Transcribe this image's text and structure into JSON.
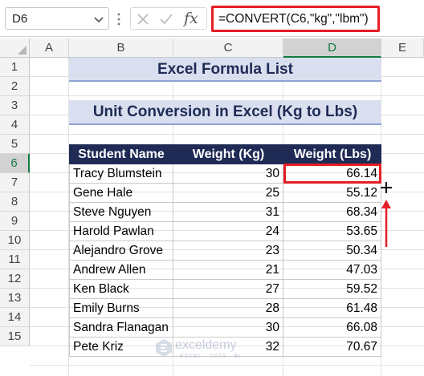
{
  "name_box": {
    "value": "D6"
  },
  "formula_bar": {
    "fx_label": "fx",
    "formula": "=CONVERT(C6,\"kg\",\"lbm\")"
  },
  "columns": [
    {
      "label": "A",
      "selected": false
    },
    {
      "label": "B",
      "selected": false
    },
    {
      "label": "C",
      "selected": false
    },
    {
      "label": "D",
      "selected": true
    },
    {
      "label": "E",
      "selected": false
    }
  ],
  "rows": [
    "1",
    "2",
    "3",
    "4",
    "5",
    "6",
    "7",
    "8",
    "9",
    "10",
    "11",
    "12",
    "13",
    "14",
    "15"
  ],
  "selected_row": "6",
  "titles": {
    "main": "Excel Formula List",
    "sub": "Unit Conversion in Excel (Kg to Lbs)"
  },
  "table": {
    "headers": [
      "Student Name",
      "Weight (Kg)",
      "Weight (Lbs)"
    ],
    "rows": [
      {
        "name": "Tracy Blumstein",
        "kg": "30",
        "lbs": "66.14"
      },
      {
        "name": "Gene Hale",
        "kg": "25",
        "lbs": "55.12"
      },
      {
        "name": "Steve Nguyen",
        "kg": "31",
        "lbs": "68.34"
      },
      {
        "name": "Harold Pawlan",
        "kg": "24",
        "lbs": "53.65"
      },
      {
        "name": "Alejandro Grove",
        "kg": "23",
        "lbs": "50.34"
      },
      {
        "name": "Andrew Allen",
        "kg": "21",
        "lbs": "47.03"
      },
      {
        "name": "Ken Black",
        "kg": "27",
        "lbs": "59.52"
      },
      {
        "name": "Emily Burns",
        "kg": "28",
        "lbs": "61.48"
      },
      {
        "name": "Sandra Flanagan",
        "kg": "30",
        "lbs": "66.08"
      },
      {
        "name": "Pete Kriz",
        "kg": "32",
        "lbs": "70.67"
      }
    ]
  },
  "watermark": {
    "name": "exceldemy",
    "tagline": "EXCEL · DATA · BI"
  },
  "colors": {
    "accent_red": "#e41f25",
    "header_navy": "#1f2a55",
    "title_fill": "#d9dfef",
    "excel_green": "#107c41"
  },
  "icons": [
    "chevron-down-icon",
    "more-vert-icon",
    "cancel-x-icon",
    "confirm-check-icon",
    "fill-handle-plus-icon",
    "up-arrow-icon",
    "exceldemy-logo-icon"
  ]
}
